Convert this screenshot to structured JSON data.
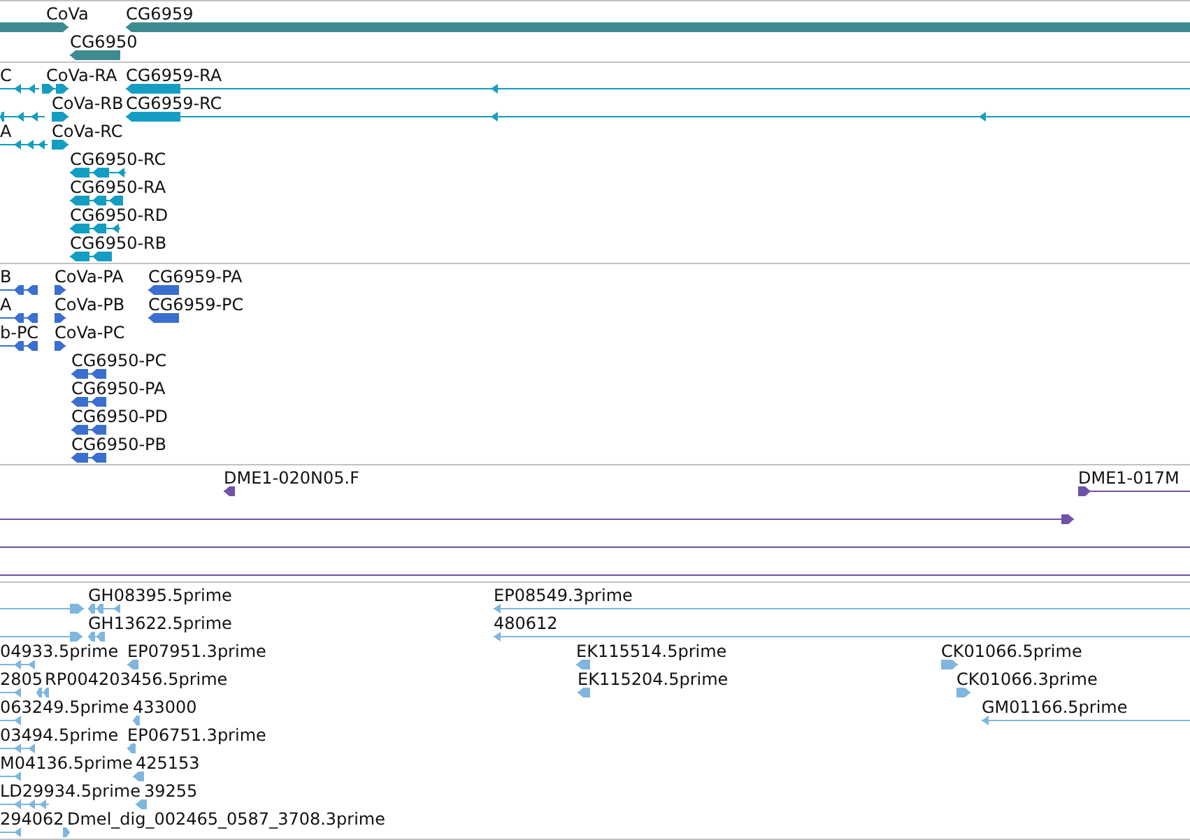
{
  "tracks": [
    {
      "color": "#3d8b90",
      "rows": [
        {
          "features": [
            {
              "label": "CoVa",
              "kind": "forward"
            },
            {
              "label": "CG6959",
              "kind": "reverse"
            }
          ]
        },
        {
          "features": [
            {
              "label": "CG6950",
              "kind": "reverse"
            }
          ]
        }
      ]
    },
    {
      "color": "#149dc2",
      "rows": [
        {
          "features": [
            {
              "label": "C",
              "kind": "reverse"
            },
            {
              "label": "CoVa-RA",
              "kind": "forward"
            },
            {
              "label": "CG6959-RA",
              "kind": "reverse"
            }
          ]
        },
        {
          "features": [
            {
              "kind": "reverse"
            },
            {
              "label": "CoVa-RB",
              "kind": "forward"
            },
            {
              "label": "CG6959-RC",
              "kind": "reverse"
            }
          ]
        },
        {
          "features": [
            {
              "label": "A",
              "kind": "reverse"
            },
            {
              "label": "CoVa-RC",
              "kind": "forward"
            }
          ]
        },
        {
          "features": [
            {
              "label": "CG6950-RC",
              "kind": "reverse"
            }
          ]
        },
        {
          "features": [
            {
              "label": "CG6950-RA",
              "kind": "reverse"
            }
          ]
        },
        {
          "features": [
            {
              "label": "CG6950-RD",
              "kind": "reverse"
            }
          ]
        },
        {
          "features": [
            {
              "label": "CG6950-RB",
              "kind": "reverse"
            }
          ]
        }
      ]
    },
    {
      "color": "#3a6fd0",
      "rows": [
        {
          "features": [
            {
              "label": "B",
              "kind": "reverse"
            },
            {
              "label": "CoVa-PA",
              "kind": "forward"
            },
            {
              "label": "CG6959-PA",
              "kind": "reverse"
            }
          ]
        },
        {
          "features": [
            {
              "label": "A",
              "kind": "reverse"
            },
            {
              "label": "CoVa-PB",
              "kind": "forward"
            },
            {
              "label": "CG6959-PC",
              "kind": "reverse"
            }
          ]
        },
        {
          "features": [
            {
              "label": "b-PC",
              "kind": "reverse"
            },
            {
              "label": "CoVa-PC",
              "kind": "forward"
            }
          ]
        },
        {
          "features": [
            {
              "label": "CG6950-PC",
              "kind": "reverse"
            }
          ]
        },
        {
          "features": [
            {
              "label": "CG6950-PA",
              "kind": "reverse"
            }
          ]
        },
        {
          "features": [
            {
              "label": "CG6950-PD",
              "kind": "reverse"
            }
          ]
        },
        {
          "features": [
            {
              "label": "CG6950-PB",
              "kind": "reverse"
            }
          ]
        }
      ]
    },
    {
      "color": "#7052a8",
      "rows": [
        {
          "features": [
            {
              "label": "DME1-020N05.F",
              "kind": "reverse"
            },
            {
              "label": "DME1-017M",
              "kind": "forward"
            }
          ]
        },
        {
          "features": [
            {
              "kind": "forward"
            }
          ]
        },
        {
          "features": [
            {
              "kind": "line"
            }
          ]
        },
        {
          "features": [
            {
              "kind": "line"
            }
          ]
        }
      ]
    },
    {
      "color": "#7fb6de",
      "rows": [
        {
          "features": [
            {
              "kind": "forward"
            },
            {
              "label": "GH08395.5prime",
              "kind": "reverse"
            },
            {
              "label": "EP08549.3prime",
              "kind": "reverse"
            }
          ]
        },
        {
          "features": [
            {
              "kind": "forward"
            },
            {
              "label": "GH13622.5prime",
              "kind": "reverse"
            },
            {
              "label": "480612",
              "kind": "reverse"
            }
          ]
        },
        {
          "features": [
            {
              "label": "04933.5prime",
              "kind": "reverse"
            },
            {
              "label": "EP07951.3prime",
              "kind": "reverse"
            },
            {
              "label": "EK115514.5prime",
              "kind": "reverse"
            },
            {
              "label": "CK01066.5prime",
              "kind": "forward"
            }
          ]
        },
        {
          "features": [
            {
              "label": "2805",
              "kind": "reverse"
            },
            {
              "label": "RP004203456.5prime",
              "kind": "reverse"
            },
            {
              "label": "EK115204.5prime",
              "kind": "reverse"
            },
            {
              "label": "CK01066.3prime",
              "kind": "forward"
            }
          ]
        },
        {
          "features": [
            {
              "label": "063249.5prime",
              "kind": "reverse"
            },
            {
              "label": "433000",
              "kind": "reverse"
            },
            {
              "label": "GM01166.5prime",
              "kind": "reverse"
            }
          ]
        },
        {
          "features": [
            {
              "label": "03494.5prime",
              "kind": "reverse"
            },
            {
              "label": "EP06751.3prime",
              "kind": "reverse"
            }
          ]
        },
        {
          "features": [
            {
              "label": "M04136.5prime",
              "kind": "reverse"
            },
            {
              "label": "425153",
              "kind": "reverse"
            }
          ]
        },
        {
          "features": [
            {
              "label": "LD29934.5prime",
              "kind": "reverse"
            },
            {
              "label": "39255",
              "kind": "reverse"
            }
          ]
        },
        {
          "features": [
            {
              "label": "294062",
              "kind": "reverse"
            },
            {
              "label": "Dmel_dig_002465_0587_3708.3prime",
              "kind": "forward"
            }
          ]
        }
      ]
    }
  ]
}
